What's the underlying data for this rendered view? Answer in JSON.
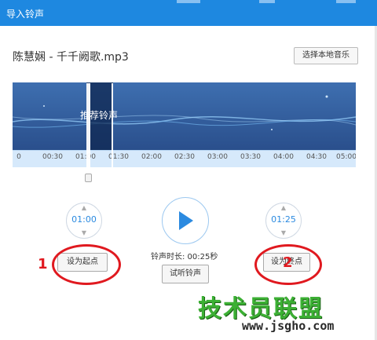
{
  "dialog": {
    "title": "导入铃声",
    "song_name": "陈慧娴 - 千千阙歌.mp3",
    "choose_local_music": "选择本地音乐"
  },
  "waveform": {
    "recommend_label": "推荐铃声",
    "ticks": [
      "0",
      "00:30",
      "01:00",
      "01:30",
      "02:00",
      "02:30",
      "03:00",
      "03:30",
      "04:00",
      "04:30",
      "05:00"
    ],
    "selection_start": "01:00",
    "selection_end": "01:25"
  },
  "controls": {
    "start_time": "01:00",
    "end_time": "01:25",
    "set_start": "设为起点",
    "set_end": "设为终点",
    "duration_label": "铃声时长: 00:25秒",
    "preview": "试听铃声"
  },
  "annotations": {
    "marker_1": "1",
    "marker_2": "2"
  },
  "watermark": {
    "text": "技术员联盟",
    "url": "www.jsgho.com"
  },
  "colors": {
    "title_bar": "#1e88e0",
    "wave_bg": "#2e5a99",
    "accent": "#2b8ae0",
    "annotation": "#e0191f"
  }
}
